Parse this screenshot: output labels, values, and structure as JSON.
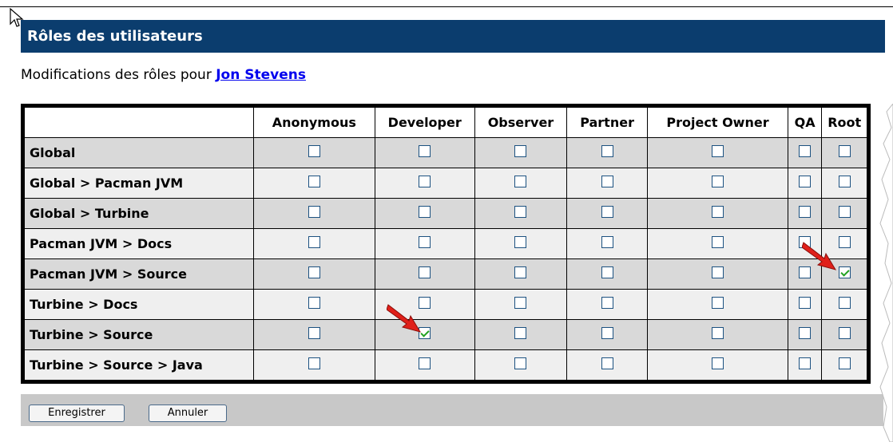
{
  "header": {
    "title": "Rôles des utilisateurs"
  },
  "subtitle": {
    "prefix": "Modifications des rôles pour ",
    "user": "Jon Stevens"
  },
  "table": {
    "columns": [
      "Anonymous",
      "Developer",
      "Observer",
      "Partner",
      "Project Owner",
      "QA",
      "Root"
    ],
    "rows": [
      {
        "label": "Global",
        "checked": [
          false,
          false,
          false,
          false,
          false,
          false,
          false
        ]
      },
      {
        "label": "Global > Pacman JVM",
        "checked": [
          false,
          false,
          false,
          false,
          false,
          false,
          false
        ]
      },
      {
        "label": "Global > Turbine",
        "checked": [
          false,
          false,
          false,
          false,
          false,
          false,
          false
        ]
      },
      {
        "label": "Pacman JVM > Docs",
        "checked": [
          false,
          false,
          false,
          false,
          false,
          false,
          false
        ]
      },
      {
        "label": "Pacman JVM > Source",
        "checked": [
          false,
          false,
          false,
          false,
          false,
          false,
          true
        ]
      },
      {
        "label": "Turbine > Docs",
        "checked": [
          false,
          false,
          false,
          false,
          false,
          false,
          false
        ]
      },
      {
        "label": "Turbine > Source",
        "checked": [
          false,
          true,
          false,
          false,
          false,
          false,
          false
        ]
      },
      {
        "label": "Turbine > Source > Java",
        "checked": [
          false,
          false,
          false,
          false,
          false,
          false,
          false
        ]
      }
    ]
  },
  "buttons": {
    "save": "Enregistrer",
    "cancel": "Annuler"
  },
  "colors": {
    "header": "#0b3d6e",
    "link": "#0000ee",
    "check": "#21a121",
    "arrow": "#e0201a"
  }
}
